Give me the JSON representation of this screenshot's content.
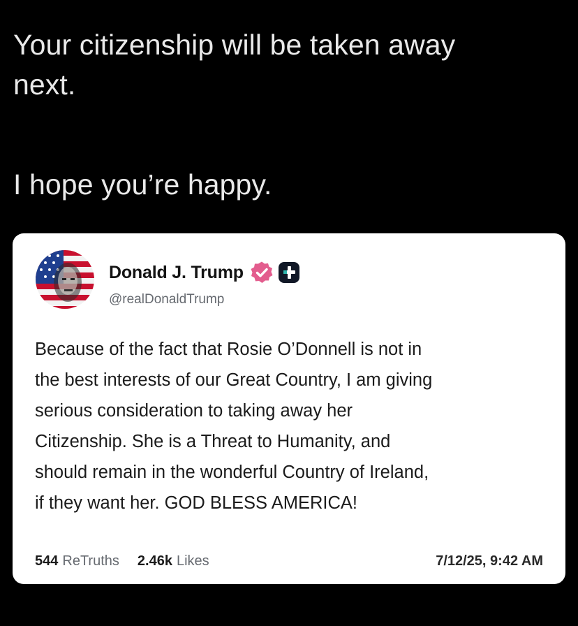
{
  "reply": {
    "line1": "Your citizenship will be taken away",
    "line2": "next.",
    "line3": "I hope you’re happy."
  },
  "card": {
    "display_name": "Donald J. Trump",
    "handle": "@realDonaldTrump",
    "verified_icon": "verified-badge-icon",
    "badge_icon": "truth-social-plus-icon",
    "body_lines": [
      "Because of the fact that Rosie O’Donnell is not in",
      "the best interests of our Great Country, I am giving",
      "serious consideration to taking away her",
      "Citizenship. She is a Threat to Humanity, and",
      "should remain in the wonderful Country of Ireland,",
      "if they want her. GOD BLESS AMERICA!"
    ],
    "retruths_count": "544",
    "retruths_label": "ReTruths",
    "likes_count": "2.46k",
    "likes_label": "Likes",
    "timestamp": "7/12/25, 9:42 AM"
  },
  "colors": {
    "background": "#000000",
    "card_background": "#ffffff",
    "verified": "#e35d8e",
    "badge": "#111827"
  }
}
